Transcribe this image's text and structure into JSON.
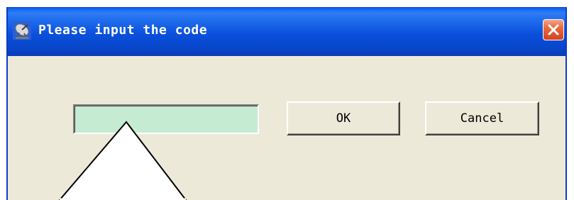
{
  "dialog": {
    "title": "Please input the code",
    "icon": "satellite-dish-icon",
    "close_icon": "close-icon"
  },
  "form": {
    "code_value": "",
    "code_placeholder": "",
    "ok_label": "OK",
    "cancel_label": "Cancel"
  },
  "colors": {
    "titlebar": "#0a4fdc",
    "window_face": "#ece9d8",
    "input_fill": "#c5ebd2",
    "close_button": "#e9693f"
  }
}
